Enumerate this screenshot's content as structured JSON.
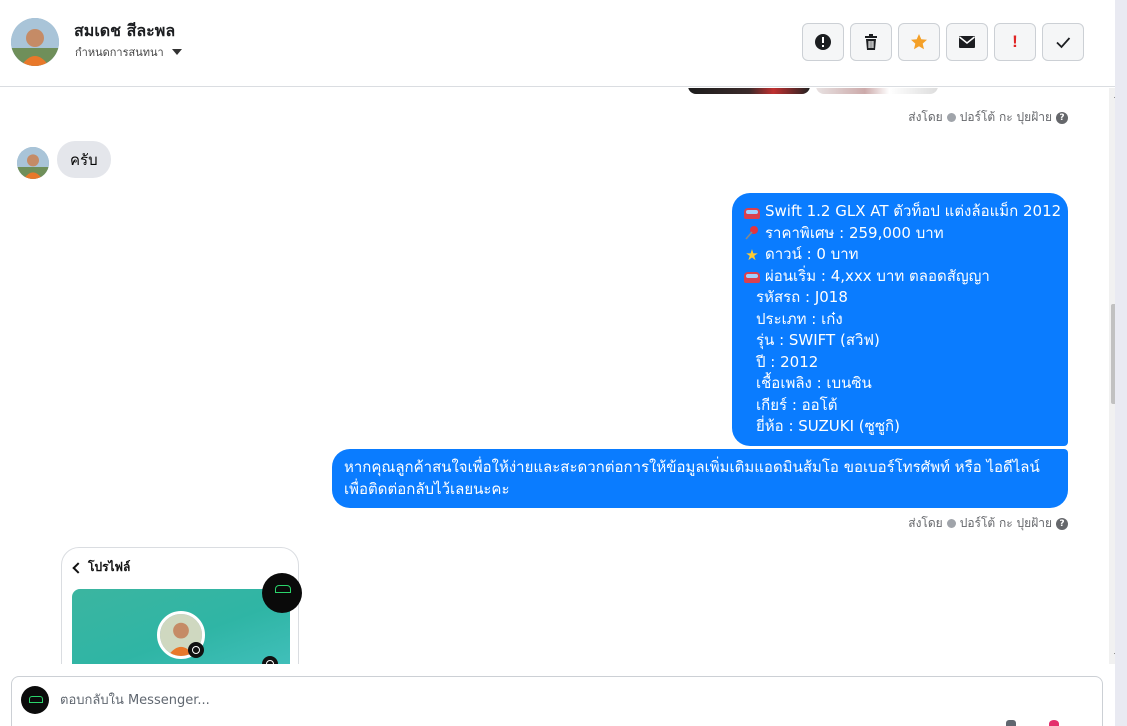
{
  "header": {
    "contact_name": "สมเดช สีละพล",
    "assign_label": "กำหนดการสนทนา",
    "actions": [
      {
        "name": "report-button",
        "icon": "alert-circle-icon"
      },
      {
        "name": "delete-button",
        "icon": "trash-icon"
      },
      {
        "name": "star-button",
        "icon": "star-icon"
      },
      {
        "name": "mark-unread-button",
        "icon": "envelope-icon"
      },
      {
        "name": "important-button",
        "icon": "exclamation-icon",
        "text": "!"
      },
      {
        "name": "done-button",
        "icon": "check-icon"
      }
    ]
  },
  "messages": {
    "sent_by_1": {
      "prefix": "ส่งโดย",
      "name": "ปอร์โต้ กะ ปุยฝ้าย"
    },
    "incoming_1": "ครับ",
    "outgoing_listing": [
      {
        "emoji": "car-emoji",
        "text": "Swift 1.2 GLX AT ตัวท็อป แต่งล้อแม็ก 2012"
      },
      {
        "emoji": "pushpin-emoji",
        "text": "ราคาพิเศษ : 259,000 บาท"
      },
      {
        "emoji": "star-emoji",
        "text": "ดาวน์ : 0 บาท"
      },
      {
        "emoji": "car-emoji",
        "text": "ผ่อนเริ่ม : 4,xxx บาท ตลอดสัญญา"
      },
      {
        "emoji": "",
        "text": "รหัสรถ : J018"
      },
      {
        "emoji": "",
        "text": "ประเภท : เก๋ง"
      },
      {
        "emoji": "",
        "text": "รุ่น : SWIFT (สวิฟ)"
      },
      {
        "emoji": "",
        "text": "ปี : 2012"
      },
      {
        "emoji": "",
        "text": "เชื้อเพลิง : เบนซิน"
      },
      {
        "emoji": "",
        "text": "เกียร์ : ออโต้"
      },
      {
        "emoji": "",
        "text": "ยี่ห้อ : SUZUKI (ซูซูกิ)"
      }
    ],
    "outgoing_request": "หากคุณลูกค้าสนใจเพื่อให้ง่ายและสะดวกต่อการให้ข้อมูลเพิ่มเติมแอดมินส้มโอ ขอเบอร์โทรศัพท์ หรือ ไอดีไลน์ เพื่อติดต่อกลับไว้เลยนะคะ",
    "sent_by_2": {
      "prefix": "ส่งโดย",
      "name": "ปอร์โต้ กะ ปุยฝ้าย"
    },
    "profile_card": {
      "back_label": "โปรไฟล์"
    }
  },
  "composer": {
    "placeholder": "ตอบกลับใน Messenger..."
  },
  "colors": {
    "bubble_out": "#0a7cff",
    "bubble_in": "#e4e6eb",
    "star": "#f4a028",
    "important": "#e02525"
  }
}
